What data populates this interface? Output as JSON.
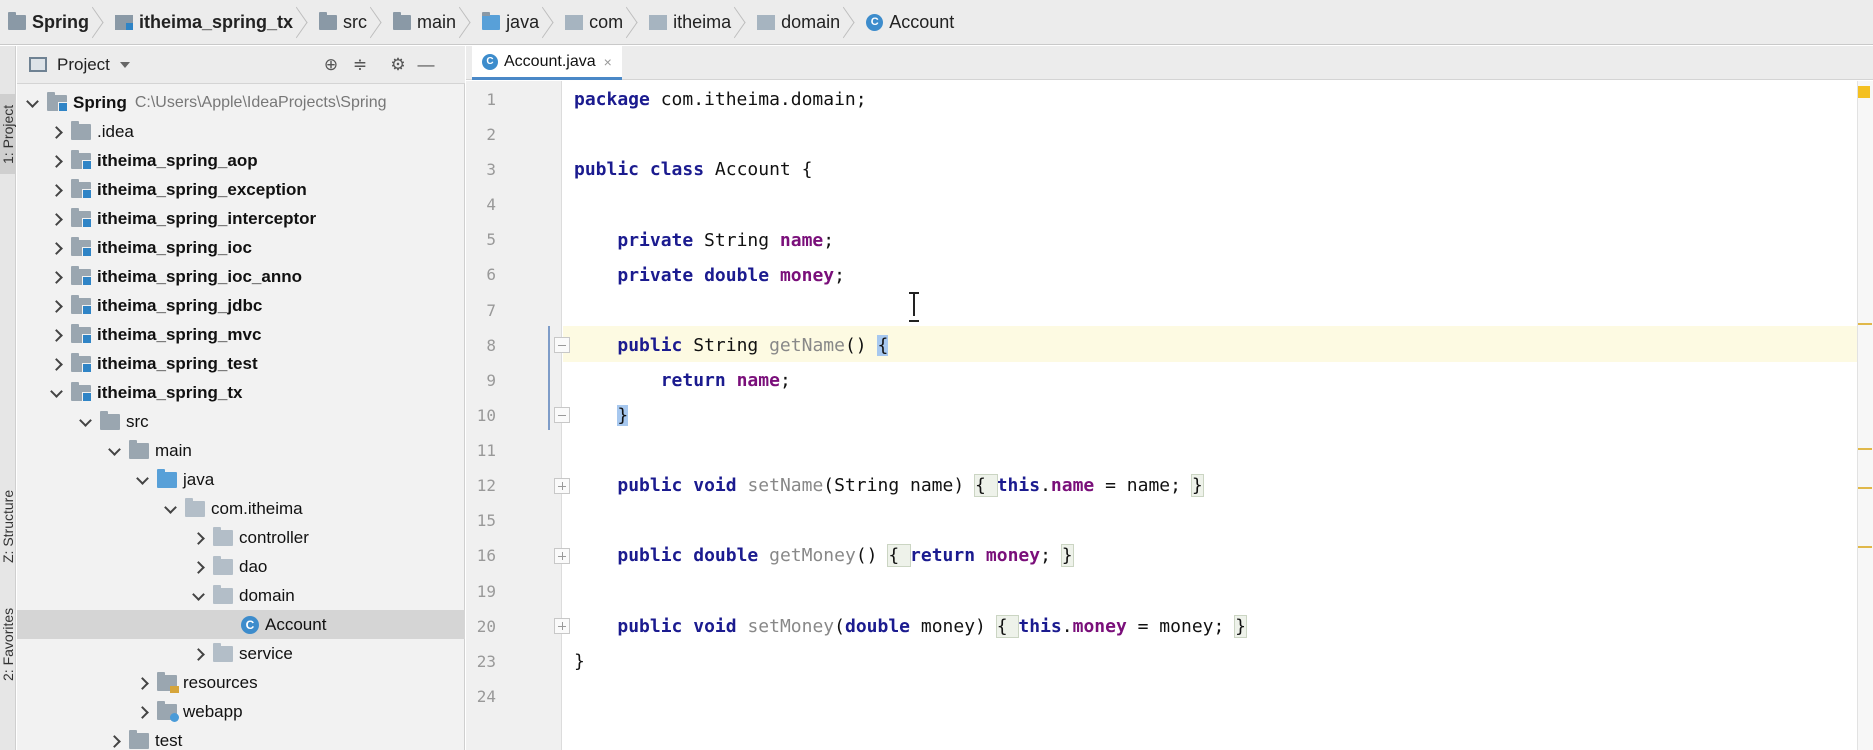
{
  "breadcrumb": {
    "items": [
      "Spring",
      "itheima_spring_tx",
      "src",
      "main",
      "java",
      "com",
      "itheima",
      "domain",
      "Account"
    ]
  },
  "toolstrip": {
    "project": "1: Project",
    "structure": "Z: Structure",
    "favorites": "2: Favorites"
  },
  "project_panel": {
    "title": "Project",
    "root_path": "C:\\Users\\Apple\\IdeaProjects\\Spring",
    "tree": [
      {
        "label": "Spring"
      },
      {
        "label": ".idea"
      },
      {
        "label": "itheima_spring_aop"
      },
      {
        "label": "itheima_spring_exception"
      },
      {
        "label": "itheima_spring_interceptor"
      },
      {
        "label": "itheima_spring_ioc"
      },
      {
        "label": "itheima_spring_ioc_anno"
      },
      {
        "label": "itheima_spring_jdbc"
      },
      {
        "label": "itheima_spring_mvc"
      },
      {
        "label": "itheima_spring_test"
      },
      {
        "label": "itheima_spring_tx"
      },
      {
        "label": "src"
      },
      {
        "label": "main"
      },
      {
        "label": "java"
      },
      {
        "label": "com.itheima"
      },
      {
        "label": "controller"
      },
      {
        "label": "dao"
      },
      {
        "label": "domain"
      },
      {
        "label": "Account"
      },
      {
        "label": "service"
      },
      {
        "label": "resources"
      },
      {
        "label": "webapp"
      },
      {
        "label": "test"
      }
    ]
  },
  "editor": {
    "tab": "Account.java",
    "tab_close": "×",
    "line_numbers": [
      "1",
      "2",
      "3",
      "4",
      "5",
      "6",
      "7",
      "8",
      "9",
      "10",
      "11",
      "12",
      "15",
      "16",
      "19",
      "20",
      "23",
      "24"
    ]
  },
  "code": {
    "l1_kw": "package",
    "l1_rest": " com.itheima.domain;",
    "l3_kw1": "public",
    "l3_kw2": "class",
    "l3_rest": " Account {",
    "l5_kw": "private",
    "l5_type": " String ",
    "l5_field": "name",
    "l5_end": ";",
    "l6_kw1": "private",
    "l6_kw2": "double",
    "l6_field": "money",
    "l6_end": ";",
    "l8_kw": "public",
    "l8_type": " String ",
    "l8_method": "getName",
    "l8_paren": "() ",
    "l8_brace": "{",
    "l9_kw": "return",
    "l9_field": "name",
    "l9_end": ";",
    "l10_brace": "}",
    "l12_kw1": "public",
    "l12_kw2": "void",
    "l12_method": "setName",
    "l12_params": "(String name) ",
    "l12_open": "{ ",
    "l12_this": "this",
    "l12_dot": ".",
    "l12_field": "name",
    "l12_assign": " = name; ",
    "l12_close": "}",
    "l16_kw1": "public",
    "l16_kw2": "double",
    "l16_method": "getMoney",
    "l16_paren": "() ",
    "l16_open": "{ ",
    "l16_ret": "return",
    "l16_field": "money",
    "l16_end": "; ",
    "l16_close": "}",
    "l20_kw1": "public",
    "l20_kw2": "void",
    "l20_method": "setMoney",
    "l20_p1": "(",
    "l20_double": "double",
    "l20_p2": " money) ",
    "l20_open": "{ ",
    "l20_this": "this",
    "l20_dot": ".",
    "l20_field": "money",
    "l20_assign": " = money; ",
    "l20_close": "}",
    "l23_brace": "}"
  }
}
